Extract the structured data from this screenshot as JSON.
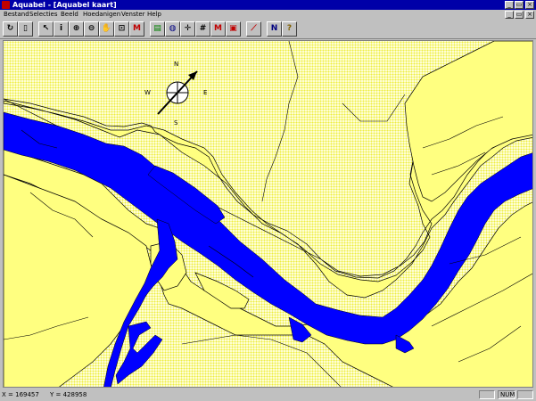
{
  "window": {
    "title": "Aquabel - [Aquabel kaart]",
    "controls": {
      "minimize": "_",
      "restore": "▭",
      "close": "×"
    }
  },
  "menu": {
    "items": [
      "Bestand",
      "Selecties",
      "Beeld",
      "Hoedanigen",
      "Venster",
      "Help"
    ],
    "mdi": {
      "minimize": "_",
      "restore": "▭",
      "close": "×"
    }
  },
  "toolbar": {
    "buttons": [
      {
        "name": "refresh-icon",
        "glyph": "↻"
      },
      {
        "name": "page-icon",
        "glyph": "▯"
      },
      {
        "name": "pointer-icon",
        "glyph": "↖"
      },
      {
        "name": "info-icon",
        "glyph": "i"
      },
      {
        "name": "zoom-in-icon",
        "glyph": "⊕"
      },
      {
        "name": "zoom-out-icon",
        "glyph": "⊖"
      },
      {
        "name": "pan-hand-icon",
        "glyph": "✋"
      },
      {
        "name": "zoom-extent-icon",
        "glyph": "⊡"
      },
      {
        "name": "m-tool-icon",
        "glyph": "M"
      },
      {
        "name": "layers-icon",
        "glyph": "▤"
      },
      {
        "name": "globe-icon",
        "glyph": "◍"
      },
      {
        "name": "north-arrow-icon",
        "glyph": "✛"
      },
      {
        "name": "grid-hash-icon",
        "glyph": "#"
      },
      {
        "name": "measure-m-icon",
        "glyph": "M"
      },
      {
        "name": "print-icon",
        "glyph": "▣"
      },
      {
        "name": "line-chart-icon",
        "glyph": "⟋"
      },
      {
        "name": "north-n-icon",
        "glyph": "N"
      },
      {
        "name": "help-query-icon",
        "glyph": "?"
      }
    ]
  },
  "compass": {
    "north": "N",
    "south": "S",
    "east": "E",
    "west": "W"
  },
  "status": {
    "x": "X = 169457",
    "y": "Y = 428958",
    "mode": "NUM"
  },
  "colors": {
    "water": "#0000ff",
    "land": "#ffff80",
    "titlebar": "#0000a8"
  }
}
